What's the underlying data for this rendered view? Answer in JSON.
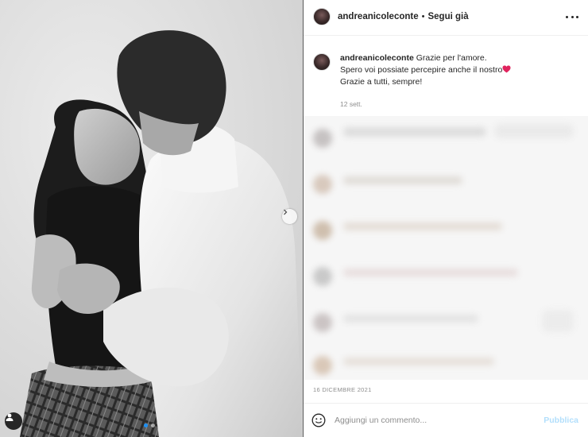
{
  "post": {
    "username": "andreanicoleconte",
    "separator": "•",
    "follow_label": "Segui già",
    "more_icon": "more-horizontal-icon",
    "caption": {
      "username": "andreanicoleconte",
      "line1": "Grazie per l'amore.",
      "line2": "Spero voi possiate percepire anche il nostro",
      "line3": "Grazie a tutti, sempre!",
      "heart_color": "#e0245e",
      "time": "12 sett."
    },
    "date": "16 DICEMBRE 2021",
    "comment_placeholder": "Aggiungi un commento...",
    "publish_label": "Pubblica",
    "carousel": {
      "count": 2,
      "active_index": 0
    },
    "colors": {
      "accent": "#1d8ff2",
      "publish_disabled": "#b2dffc",
      "secondary_text": "#8e8e8e"
    }
  }
}
